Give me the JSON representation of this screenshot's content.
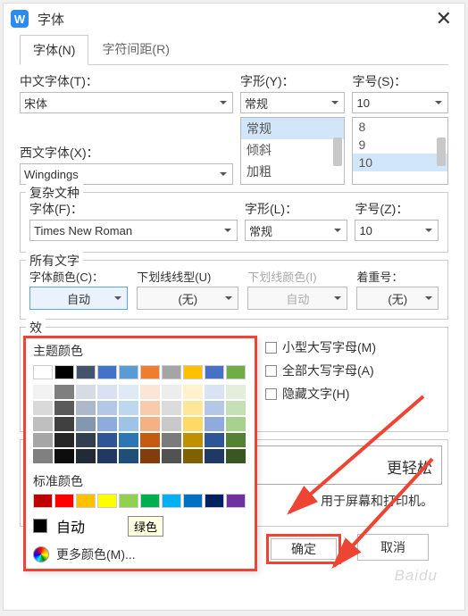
{
  "titlebar": {
    "app_letter": "W",
    "title": "字体"
  },
  "tabs": {
    "font": "字体(N)",
    "spacing": "字符间距(R)"
  },
  "cn": {
    "label": "中文字体(T)：",
    "value": "宋体"
  },
  "style": {
    "label": "字形(Y)：",
    "value": "常规",
    "options": [
      "常规",
      "倾斜",
      "加粗"
    ]
  },
  "size": {
    "label": "字号(S)：",
    "value": "10",
    "options": [
      "8",
      "9",
      "10"
    ]
  },
  "western": {
    "label": "西文字体(X)：",
    "value": "Wingdings"
  },
  "complex": {
    "legend": "复杂文种",
    "font_label": "字体(F)：",
    "font_value": "Times New Roman",
    "style_label": "字形(L)：",
    "style_value": "常规",
    "size_label": "字号(Z)：",
    "size_value": "10"
  },
  "alltext": {
    "legend": "所有文字",
    "color_label": "字体颜色(C)：",
    "color_value": "自动",
    "underline_label": "下划线线型(U)",
    "underline_value": "(无)",
    "underline_color_label": "下划线颜色(I)",
    "underline_color_value": "自动",
    "emphasis_label": "着重号：",
    "emphasis_value": "(无)"
  },
  "effects": {
    "legend_partial": "效",
    "smallcaps": "小型大写字母(M)",
    "allcaps": "全部大写字母(A)",
    "hidden": "隐藏文字(H)"
  },
  "preview_text": "更轻松",
  "footer_msg": "用于屏幕和打印机。",
  "buttons": {
    "ok": "确定",
    "cancel": "取消"
  },
  "color_popup": {
    "theme_title": "主题颜色",
    "standard_title": "标准颜色",
    "auto_label": "自动",
    "tooltip": "绿色",
    "more": "更多颜色(M)...",
    "theme_row": [
      "#ffffff",
      "#000000",
      "#44546a",
      "#4472c4",
      "#5b9bd5",
      "#ed7d31",
      "#a5a5a5",
      "#ffc000",
      "#4572c4",
      "#70ad47"
    ],
    "tints": [
      [
        "#f2f2f2",
        "#7f7f7f",
        "#d6dce5",
        "#d9e2f3",
        "#deebf7",
        "#fbe5d6",
        "#ededed",
        "#fff2cc",
        "#dae3f3",
        "#e2efda"
      ],
      [
        "#d9d9d9",
        "#595959",
        "#adb9ca",
        "#b4c7e7",
        "#bdd7ee",
        "#f8cbad",
        "#dbdbdb",
        "#ffe699",
        "#b4c7e7",
        "#c5e0b4"
      ],
      [
        "#bfbfbf",
        "#404040",
        "#8497b0",
        "#8faadc",
        "#9dc3e6",
        "#f4b183",
        "#c9c9c9",
        "#ffd966",
        "#8faadc",
        "#a9d18e"
      ],
      [
        "#a6a6a6",
        "#262626",
        "#333f50",
        "#2f5597",
        "#2e75b6",
        "#c55a11",
        "#7b7b7b",
        "#bf9000",
        "#2f5597",
        "#548235"
      ],
      [
        "#808080",
        "#0d0d0d",
        "#222a35",
        "#1f3864",
        "#1f4e79",
        "#843c0c",
        "#525252",
        "#806000",
        "#1f3864",
        "#385723"
      ]
    ],
    "standard": [
      "#c00000",
      "#ff0000",
      "#ffc000",
      "#ffff00",
      "#92d050",
      "#00b050",
      "#00b0f0",
      "#0070c0",
      "#002060",
      "#7030a0"
    ]
  },
  "watermark": "Baidu"
}
